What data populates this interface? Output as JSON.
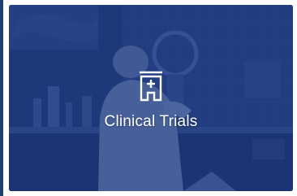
{
  "card": {
    "title": "Clinical Trials",
    "icon": "clinic-building-icon",
    "overlay_color": "#1c3476"
  }
}
